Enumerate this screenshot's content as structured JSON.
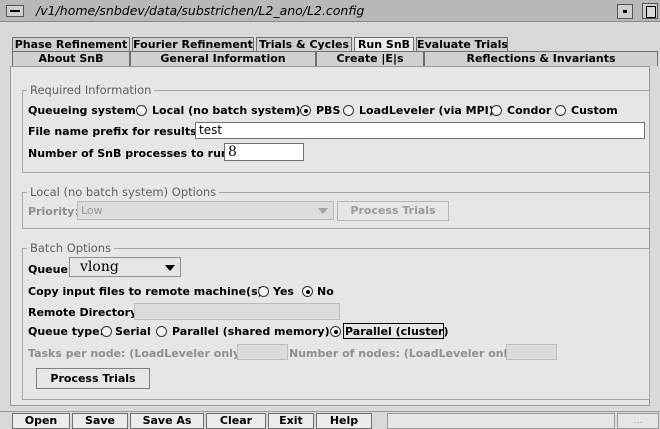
{
  "window": {
    "title": "/v1/home/snbdev/data/substrichen/L2_ano/L2.config"
  },
  "tabs": {
    "row1": [
      {
        "label": "Phase Refinement"
      },
      {
        "label": "Fourier Refinement"
      },
      {
        "label": "Trials & Cycles"
      },
      {
        "label": "Run SnB",
        "active": true
      },
      {
        "label": "Evaluate Trials"
      }
    ],
    "row2": [
      {
        "label": "About SnB"
      },
      {
        "label": "General Information"
      },
      {
        "label": "Create |E|s"
      },
      {
        "label": "Reflections & Invariants"
      }
    ]
  },
  "required": {
    "legend": "Required Information",
    "queueing_label": "Queueing system:",
    "queueing_options": [
      {
        "label": "Local (no batch system)",
        "selected": false
      },
      {
        "label": "PBS",
        "selected": true
      },
      {
        "label": "LoadLeveler (via MPI)",
        "selected": false
      },
      {
        "label": "Condor",
        "selected": false
      },
      {
        "label": "Custom",
        "selected": false
      }
    ],
    "prefix_label": "File name prefix for results:",
    "prefix_value": "test",
    "processes_label": "Number of SnB processes to run:",
    "processes_value": "8"
  },
  "local": {
    "legend": "Local (no batch system) Options",
    "priority_label": "Priority:",
    "priority_value": "Low",
    "process_button": "Process Trials"
  },
  "batch": {
    "legend": "Batch Options",
    "queue_label": "Queue:",
    "queue_value": "vlong",
    "copy_label": "Copy input files to remote machine(s)?",
    "copy_yes": "Yes",
    "copy_no": "No",
    "copy_selected": "No",
    "remote_dir_label": "Remote Directory:",
    "remote_dir_value": "",
    "queue_type_label": "Queue type:",
    "queue_type_options": [
      {
        "label": "Serial",
        "selected": false
      },
      {
        "label": "Parallel (shared memory)",
        "selected": false
      },
      {
        "label": "Parallel (cluster)",
        "selected": true
      }
    ],
    "tasks_label": "Tasks per node: (LoadLeveler only)",
    "tasks_value": "",
    "nodes_label": "Number of nodes: (LoadLeveler only)",
    "nodes_value": "",
    "process_button": "Process Trials"
  },
  "bottom": {
    "buttons": [
      "Open",
      "Save",
      "Save As",
      "Clear",
      "Exit",
      "Help"
    ],
    "more_label": "..."
  },
  "colors": {
    "background": "#d9d9d9",
    "panel": "#e6e6e6",
    "legend_text": "#606060",
    "disabled_text": "#8f8f8f"
  }
}
